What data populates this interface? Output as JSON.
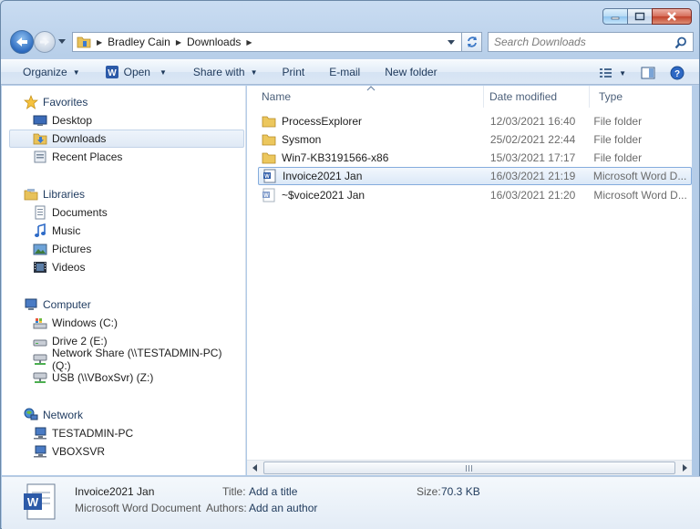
{
  "address": {
    "crumbs": [
      "Bradley Cain",
      "Downloads"
    ],
    "search_placeholder": "Search Downloads"
  },
  "toolbar": {
    "organize": "Organize",
    "open": "Open",
    "share_with": "Share with",
    "print": "Print",
    "email": "E-mail",
    "new_folder": "New folder"
  },
  "nav": {
    "favorites": "Favorites",
    "desktop": "Desktop",
    "downloads": "Downloads",
    "recent_places": "Recent Places",
    "libraries": "Libraries",
    "documents": "Documents",
    "music": "Music",
    "pictures": "Pictures",
    "videos": "Videos",
    "computer": "Computer",
    "drive_c": "Windows (C:)",
    "drive_e": "Drive 2 (E:)",
    "drive_q": "Network Share (\\\\TESTADMIN-PC) (Q:)",
    "drive_z": "USB (\\\\VBoxSvr) (Z:)",
    "network": "Network",
    "net_pc1": "TESTADMIN-PC",
    "net_pc2": "VBOXSVR"
  },
  "columns": {
    "name": "Name",
    "date": "Date modified",
    "type": "Type"
  },
  "files": [
    {
      "name": "ProcessExplorer",
      "date": "12/03/2021 16:40",
      "type": "File folder"
    },
    {
      "name": "Sysmon",
      "date": "25/02/2021 22:44",
      "type": "File folder"
    },
    {
      "name": "Win7-KB3191566-x86",
      "date": "15/03/2021 17:17",
      "type": "File folder"
    },
    {
      "name": "Invoice2021 Jan",
      "date": "16/03/2021 21:19",
      "type": "Microsoft Word D..."
    },
    {
      "name": "~$voice2021 Jan",
      "date": "16/03/2021 21:20",
      "type": "Microsoft Word D..."
    }
  ],
  "details": {
    "file_name": "Invoice2021 Jan",
    "file_kind": "Microsoft Word Document",
    "title_label": "Title:",
    "title_value": "Add a title",
    "authors_label": "Authors:",
    "authors_value": "Add an author",
    "size_label": "Size:",
    "size_value": "70.3 KB"
  },
  "colors": {
    "accent": "#1e395b",
    "selection_border": "#84acdd",
    "close_button": "#c2432c"
  }
}
